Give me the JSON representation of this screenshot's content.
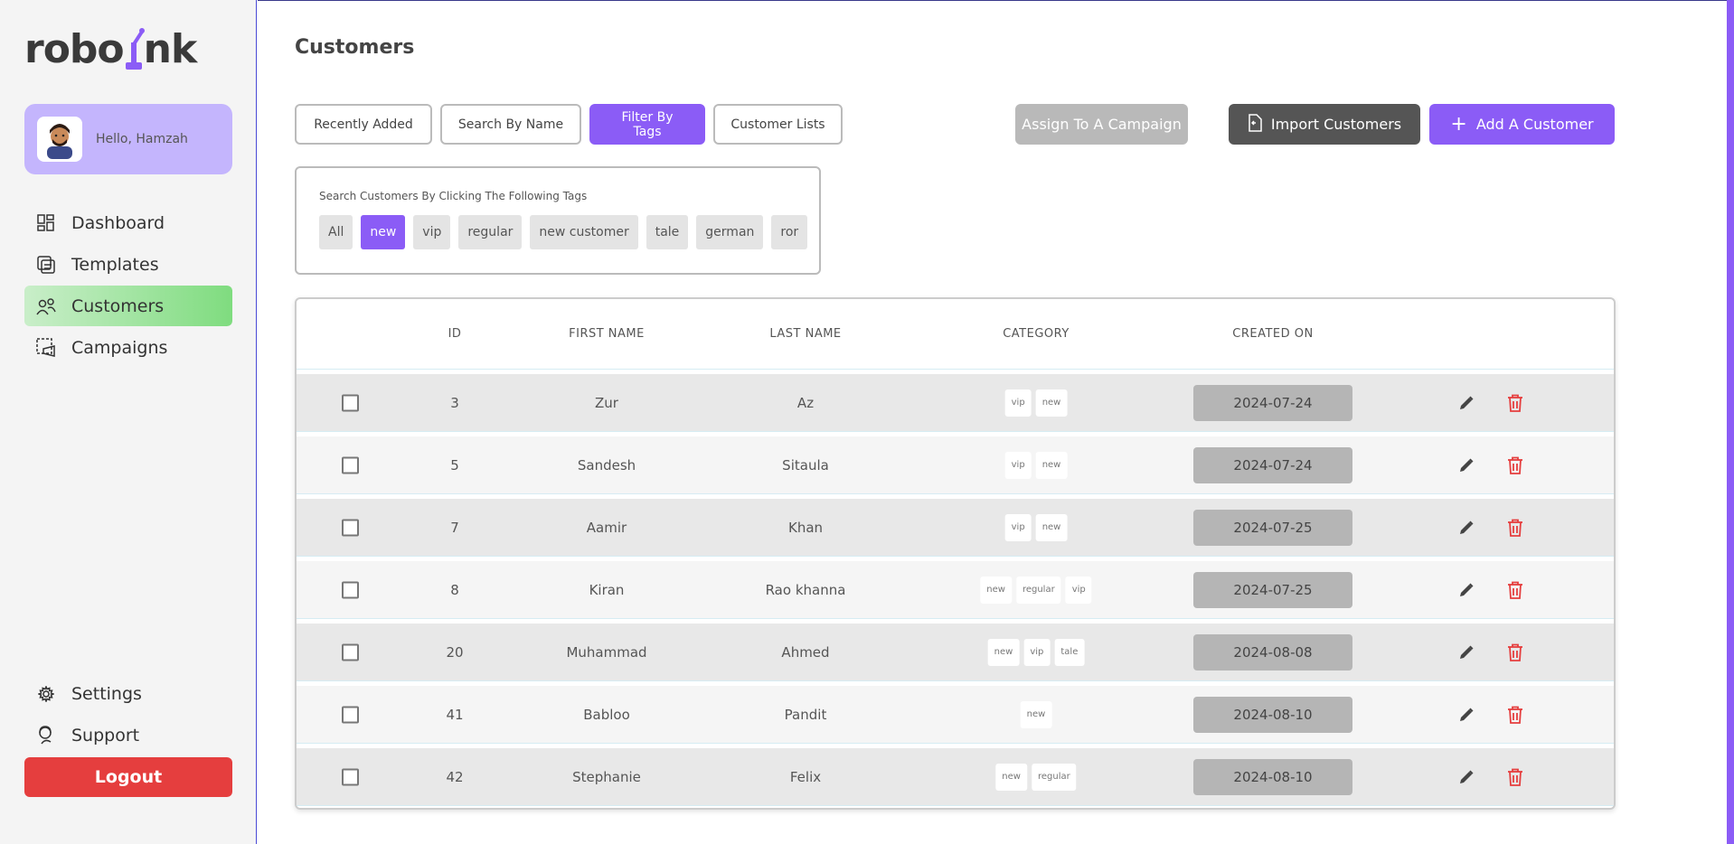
{
  "logo": {
    "text_left": "robo",
    "text_right": "nk"
  },
  "user": {
    "greeting": "Hello, Hamzah"
  },
  "nav": [
    {
      "label": "Dashboard",
      "icon": "dashboard-icon"
    },
    {
      "label": "Templates",
      "icon": "templates-icon"
    },
    {
      "label": "Customers",
      "icon": "customers-icon"
    },
    {
      "label": "Campaigns",
      "icon": "campaigns-icon"
    }
  ],
  "bottom_nav": [
    {
      "label": "Settings",
      "icon": "gear-icon"
    },
    {
      "label": "Support",
      "icon": "support-icon"
    }
  ],
  "logout_label": "Logout",
  "page": {
    "title": "Customers"
  },
  "tabs": [
    {
      "label": "Recently Added"
    },
    {
      "label": "Search By Name"
    },
    {
      "label": "Filter By Tags"
    },
    {
      "label": "Customer Lists"
    }
  ],
  "actions": {
    "assign": "Assign To A Campaign",
    "import": "Import Customers",
    "add": "Add A Customer"
  },
  "tag_filter": {
    "hint": "Search Customers By Clicking The Following Tags",
    "tags": [
      "All",
      "new",
      "vip",
      "regular",
      "new customer",
      "tale",
      "german",
      "ror"
    ],
    "selected": "new"
  },
  "table": {
    "headers": {
      "id": "ID",
      "first_name": "FIRST NAME",
      "last_name": "LAST NAME",
      "category": "CATEGORY",
      "created_on": "CREATED ON"
    },
    "rows": [
      {
        "id": "3",
        "first_name": "Zur",
        "last_name": "Az",
        "categories": [
          "vip",
          "new"
        ],
        "created_on": "2024-07-24"
      },
      {
        "id": "5",
        "first_name": "Sandesh",
        "last_name": "Sitaula",
        "categories": [
          "vip",
          "new"
        ],
        "created_on": "2024-07-24"
      },
      {
        "id": "7",
        "first_name": "Aamir",
        "last_name": "Khan",
        "categories": [
          "vip",
          "new"
        ],
        "created_on": "2024-07-25"
      },
      {
        "id": "8",
        "first_name": "Kiran",
        "last_name": "Rao khanna",
        "categories": [
          "new",
          "regular",
          "vip"
        ],
        "created_on": "2024-07-25"
      },
      {
        "id": "20",
        "first_name": "Muhammad",
        "last_name": "Ahmed",
        "categories": [
          "new",
          "vip",
          "tale"
        ],
        "created_on": "2024-08-08"
      },
      {
        "id": "41",
        "first_name": "Babloo",
        "last_name": "Pandit",
        "categories": [
          "new"
        ],
        "created_on": "2024-08-10"
      },
      {
        "id": "42",
        "first_name": "Stephanie",
        "last_name": "Felix",
        "categories": [
          "new",
          "regular"
        ],
        "created_on": "2024-08-10"
      }
    ]
  },
  "colors": {
    "accent": "#8b5cf6",
    "logout": "#e53e3e",
    "delete": "#e53e3e",
    "active_nav": "#7fdc7f"
  }
}
